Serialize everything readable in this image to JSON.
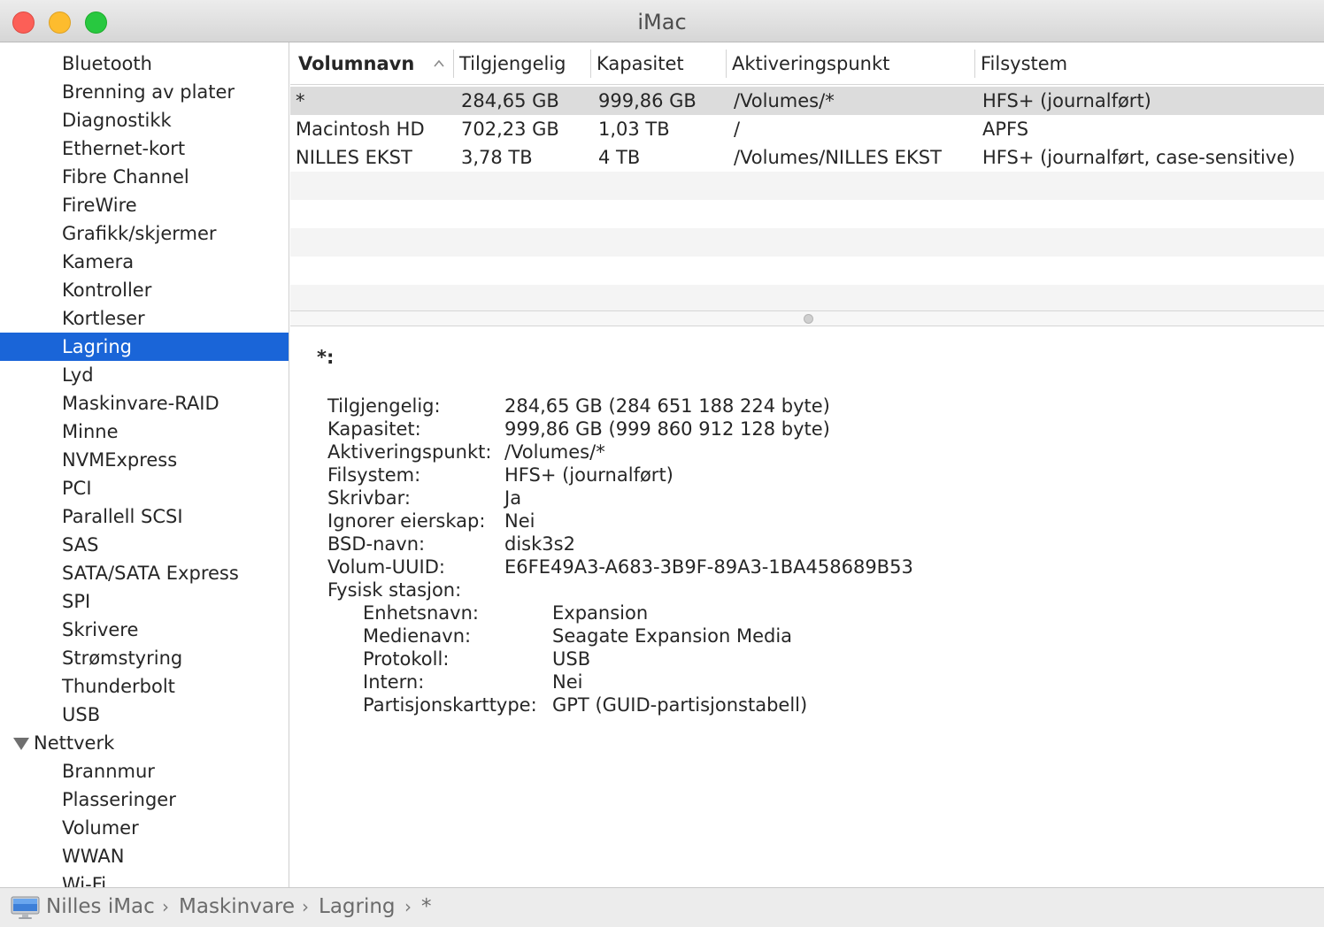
{
  "window": {
    "title": "iMac"
  },
  "sidebar": {
    "selected_color": "#1a65d8",
    "items": [
      {
        "label": "Bluetooth",
        "type": "item"
      },
      {
        "label": "Brenning av plater",
        "type": "item"
      },
      {
        "label": "Diagnostikk",
        "type": "item"
      },
      {
        "label": "Ethernet-kort",
        "type": "item"
      },
      {
        "label": "Fibre Channel",
        "type": "item"
      },
      {
        "label": "FireWire",
        "type": "item"
      },
      {
        "label": "Grafikk/skjermer",
        "type": "item"
      },
      {
        "label": "Kamera",
        "type": "item"
      },
      {
        "label": "Kontroller",
        "type": "item"
      },
      {
        "label": "Kortleser",
        "type": "item"
      },
      {
        "label": "Lagring",
        "type": "item",
        "selected": true
      },
      {
        "label": "Lyd",
        "type": "item"
      },
      {
        "label": "Maskinvare-RAID",
        "type": "item"
      },
      {
        "label": "Minne",
        "type": "item"
      },
      {
        "label": "NVMExpress",
        "type": "item"
      },
      {
        "label": "PCI",
        "type": "item"
      },
      {
        "label": "Parallell SCSI",
        "type": "item"
      },
      {
        "label": "SAS",
        "type": "item"
      },
      {
        "label": "SATA/SATA Express",
        "type": "item"
      },
      {
        "label": "SPI",
        "type": "item"
      },
      {
        "label": "Skrivere",
        "type": "item"
      },
      {
        "label": "Strømstyring",
        "type": "item"
      },
      {
        "label": "Thunderbolt",
        "type": "item"
      },
      {
        "label": "USB",
        "type": "item"
      },
      {
        "label": "Nettverk",
        "type": "category"
      },
      {
        "label": "Brannmur",
        "type": "item"
      },
      {
        "label": "Plasseringer",
        "type": "item"
      },
      {
        "label": "Volumer",
        "type": "item"
      },
      {
        "label": "WWAN",
        "type": "item"
      },
      {
        "label": "Wi-Fi",
        "type": "item"
      }
    ]
  },
  "table": {
    "columns": [
      "Volumnavn",
      "Tilgjengelig",
      "Kapasitet",
      "Aktiveringspunkt",
      "Filsystem"
    ],
    "sorted_column": "Volumnavn",
    "rows": [
      [
        "*",
        "284,65 GB",
        "999,86 GB",
        "/Volumes/*",
        "HFS+ (journalført)"
      ],
      [
        "Macintosh HD",
        "702,23 GB",
        "1,03 TB",
        "/",
        "APFS"
      ],
      [
        "NILLES EKST",
        "3,78 TB",
        "4 TB",
        "/Volumes/NILLES EKST",
        "HFS+ (journalført, case-sensitive)"
      ]
    ],
    "selected_row": 0
  },
  "detail": {
    "title": "*:",
    "fields": [
      {
        "label": "Tilgjengelig:",
        "value": "284,65 GB (284 651 188 224 byte)"
      },
      {
        "label": "Kapasitet:",
        "value": "999,86 GB (999 860 912 128 byte)"
      },
      {
        "label": "Aktiveringspunkt:",
        "value": "/Volumes/*"
      },
      {
        "label": "Filsystem:",
        "value": "HFS+ (journalført)"
      },
      {
        "label": "Skrivbar:",
        "value": "Ja"
      },
      {
        "label": "Ignorer eierskap:",
        "value": "Nei"
      },
      {
        "label": "BSD-navn:",
        "value": "disk3s2"
      },
      {
        "label": "Volum-UUID:",
        "value": "E6FE49A3-A683-3B9F-89A3-1BA458689B53"
      },
      {
        "label": "Fysisk stasjon:",
        "value": ""
      }
    ],
    "sub_fields": [
      {
        "label": "Enhetsnavn:",
        "value": "Expansion"
      },
      {
        "label": "Medienavn:",
        "value": "Seagate Expansion Media"
      },
      {
        "label": "Protokoll:",
        "value": "USB"
      },
      {
        "label": "Intern:",
        "value": "Nei"
      },
      {
        "label": "Partisjonskarttype:",
        "value": "GPT (GUID-partisjonstabell)"
      }
    ]
  },
  "pathbar": {
    "icon": "imac-icon",
    "segments": [
      "Nilles iMac",
      "Maskinvare",
      "Lagring",
      "*"
    ]
  }
}
